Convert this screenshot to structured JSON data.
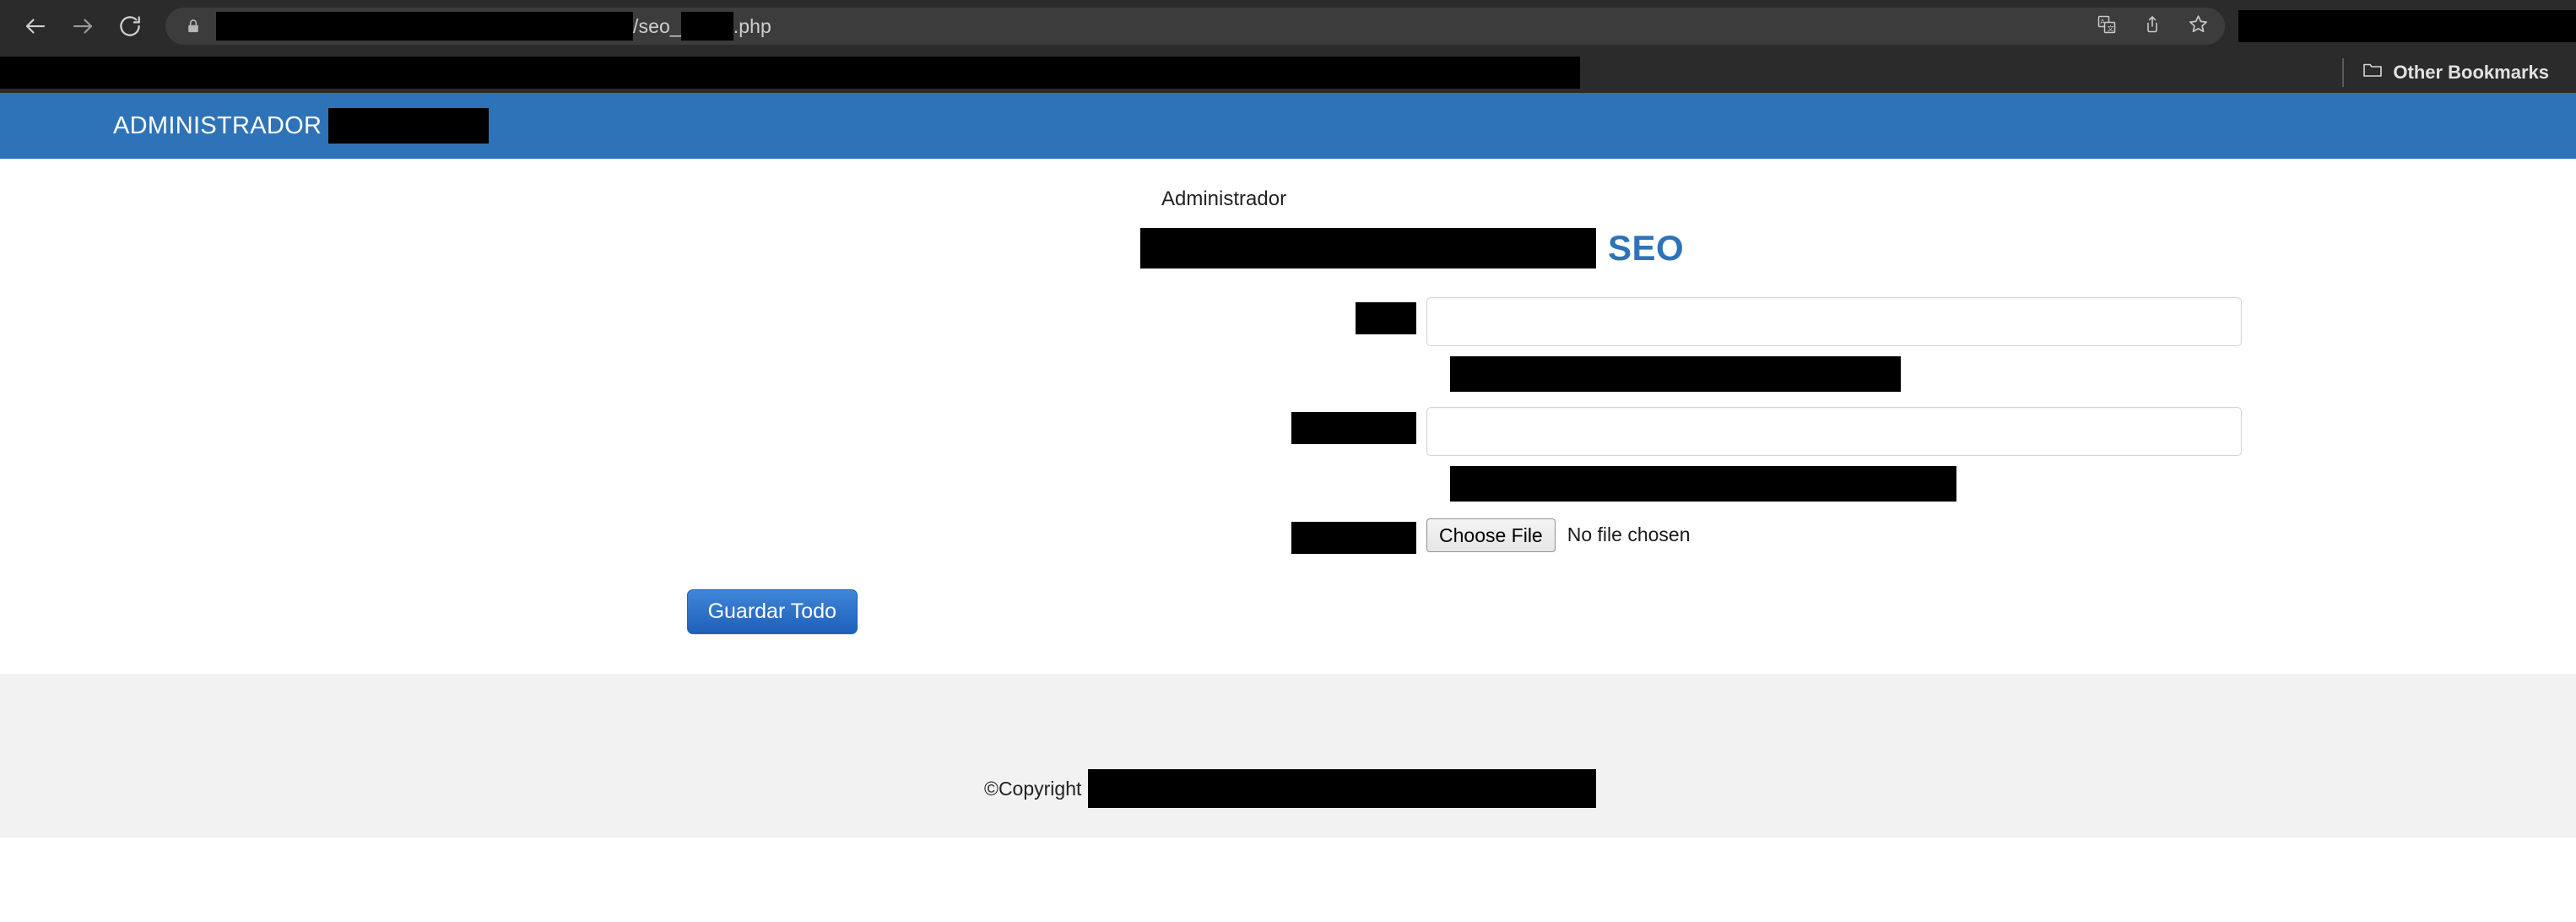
{
  "browser": {
    "back_icon": "back-arrow-icon",
    "forward_icon": "forward-arrow-icon",
    "reload_icon": "reload-icon",
    "lock_icon": "lock-icon",
    "url_visible_text": "/seo_",
    "url_suffix": ".php",
    "translate_icon": "translate-icon",
    "share_icon": "share-icon",
    "bookmark_icon": "bookmark-star-icon",
    "bookmarks": {
      "folder_icon": "folder-icon",
      "other_bookmarks_label": "Other Bookmarks"
    }
  },
  "header": {
    "title": "ADMINISTRADOR",
    "background_color": "#2e73b8",
    "text_color": "#ffffff"
  },
  "main": {
    "breadcrumb": "Administrador",
    "section_title": "SEO",
    "section_title_color": "#2e73b8",
    "fields": [
      {
        "label": "",
        "value": "",
        "placeholder": ""
      },
      {
        "label": "",
        "value": "",
        "placeholder": ""
      }
    ],
    "file_field": {
      "choose_file_label": "Choose File",
      "no_file_label": "No file chosen"
    },
    "submit_label": "Guardar Todo",
    "submit_color": "#2e73b8"
  },
  "footer": {
    "copyright_label": "©Copyright",
    "background_color": "#f2f2f2"
  }
}
